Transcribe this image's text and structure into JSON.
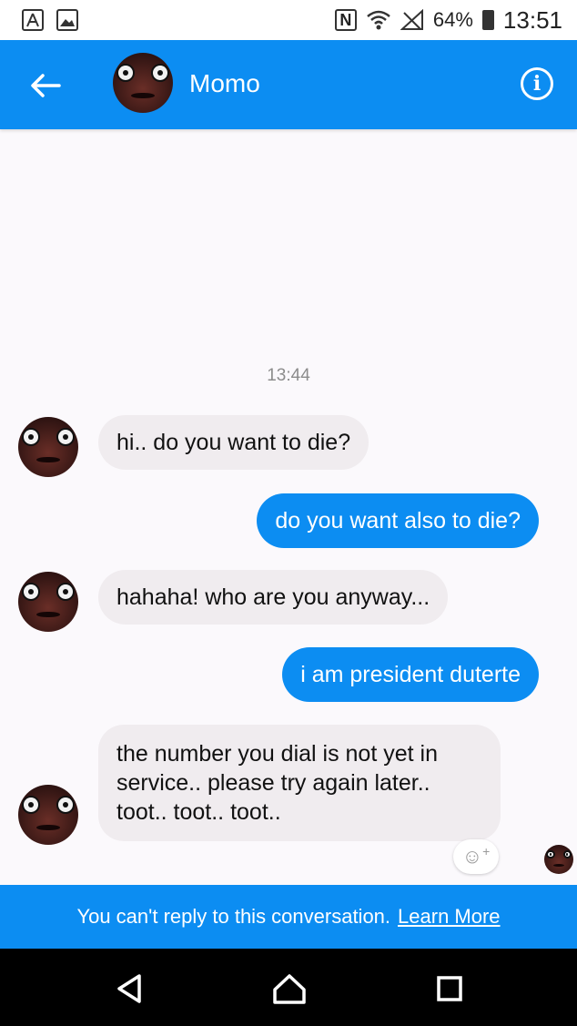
{
  "status_bar": {
    "battery": "64%",
    "time": "13:51",
    "nfc_label": "N"
  },
  "header": {
    "back_icon": "arrow-left-icon",
    "contact_name": "Momo",
    "info_icon": "info-icon",
    "info_glyph": "i"
  },
  "conversation": {
    "timestamp": "13:44",
    "messages": [
      {
        "direction": "in",
        "text": "hi.. do you want to die?"
      },
      {
        "direction": "out",
        "text": "do you want also to die?"
      },
      {
        "direction": "in",
        "text": "hahaha! who are you anyway..."
      },
      {
        "direction": "out",
        "text": "i am president duterte"
      },
      {
        "direction": "in",
        "text": "the number you dial is not yet in service.. please try again later.. toot.. toot.. toot.."
      }
    ],
    "react_glyph": "☺",
    "react_plus": "+"
  },
  "footer": {
    "notice": "You can't reply to this conversation.",
    "link": "Learn More"
  },
  "colors": {
    "accent": "#0c8df2",
    "incoming_bubble": "#f0ecef",
    "background": "#fbf9fc"
  }
}
